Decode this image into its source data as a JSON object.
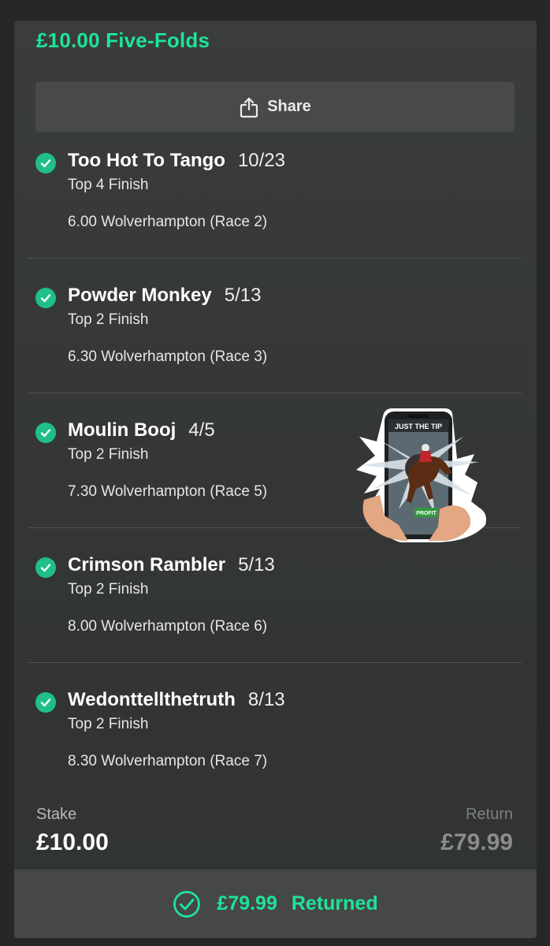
{
  "bet": {
    "title": "£10.00 Five-Folds",
    "share_label": "Share",
    "legs": [
      {
        "runner": "Too Hot To Tango",
        "odds": "10/23",
        "market": "Top 4 Finish",
        "event": "6.00 Wolverhampton (Race 2)"
      },
      {
        "runner": "Powder Monkey",
        "odds": "5/13",
        "market": "Top 2 Finish",
        "event": "6.30 Wolverhampton (Race 3)"
      },
      {
        "runner": "Moulin Booj",
        "odds": "4/5",
        "market": "Top 2 Finish",
        "event": "7.30 Wolverhampton (Race 5)"
      },
      {
        "runner": "Crimson Rambler",
        "odds": "5/13",
        "market": "Top 2 Finish",
        "event": "8.00 Wolverhampton (Race 6)"
      },
      {
        "runner": "Wedonttellthetruth",
        "odds": "8/13",
        "market": "Top 2 Finish",
        "event": "8.30 Wolverhampton (Race 7)"
      }
    ],
    "stake_label": "Stake",
    "stake_value": "£10.00",
    "return_label": "Return",
    "return_value": "£79.99",
    "returned_amount": "£79.99",
    "returned_text": "Returned"
  },
  "sticker": {
    "title": "JUST THE TIP",
    "button": "PROFIT"
  },
  "colors": {
    "accent": "#1ee39b",
    "check": "#1fbf87",
    "card": "#363937",
    "bar": "#454846"
  },
  "icons": {
    "share": "share-icon",
    "leg_status": "check-circle-icon",
    "returned": "check-circle-outline-icon"
  }
}
